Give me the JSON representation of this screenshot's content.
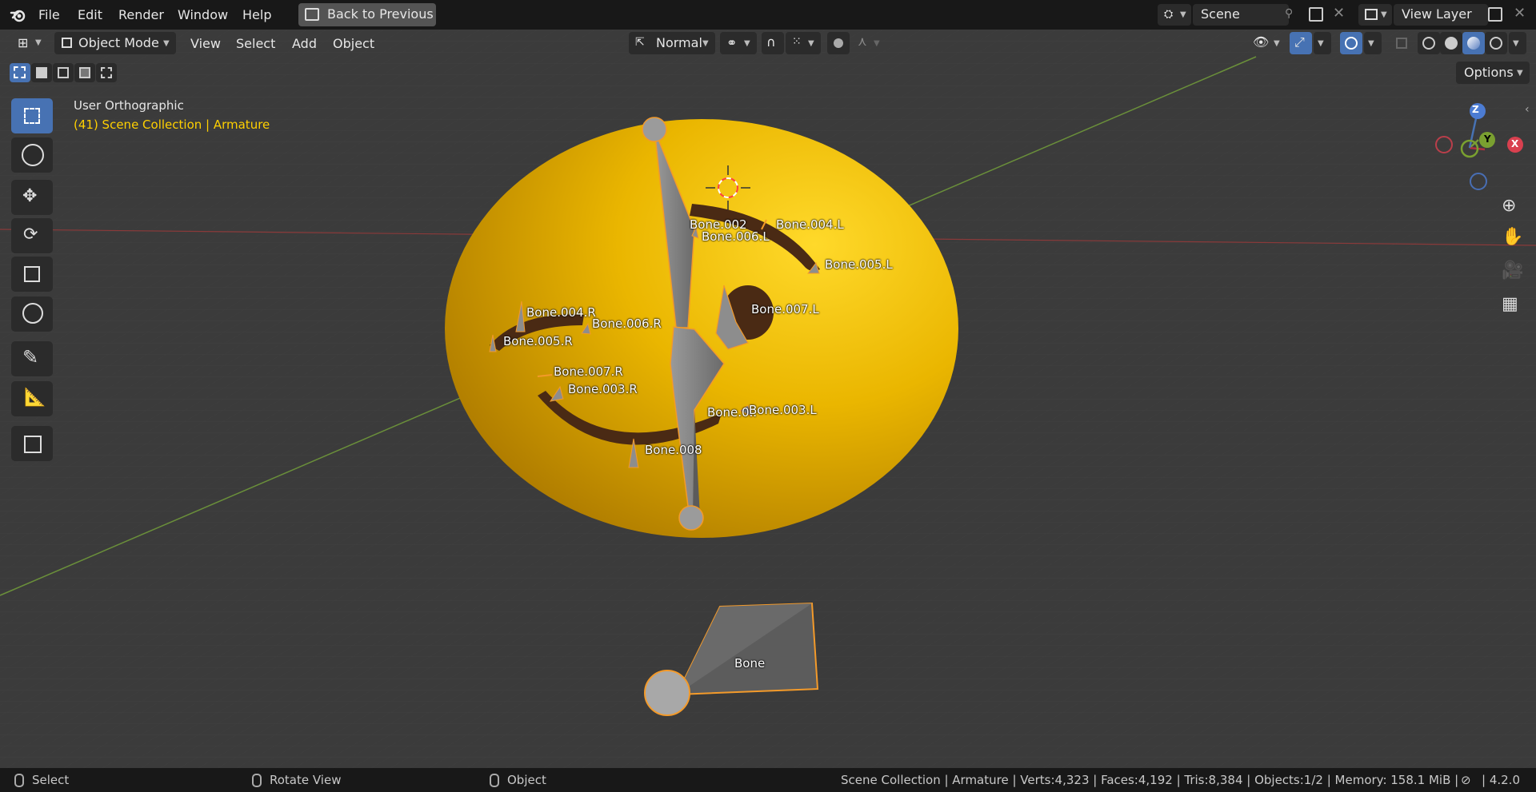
{
  "menubar": {
    "items": [
      "File",
      "Edit",
      "Render",
      "Window",
      "Help"
    ],
    "back_button": "Back to Previous",
    "scene": "Scene",
    "view_layer": "View Layer"
  },
  "header": {
    "mode": "Object Mode",
    "menus": [
      "View",
      "Select",
      "Add",
      "Object"
    ],
    "orientation": "Normal",
    "options": "Options"
  },
  "viewport": {
    "view_name": "User Orthographic",
    "collection_info": "(41) Scene Collection | Armature",
    "axes": {
      "x": "X",
      "y": "Y",
      "z": "Z"
    },
    "bone_labels": [
      "Bone.002",
      "Bone.004.L",
      "Bone.006.L",
      "Bone.005.L",
      "Bone.007.L",
      "Bone.004.R",
      "Bone.006.R",
      "Bone.005.R",
      "Bone.007.R",
      "Bone.003.R",
      "Bone.003.L",
      "Bone.0..",
      "Bone.008",
      "Bone"
    ]
  },
  "statusbar": {
    "select": "Select",
    "rotate": "Rotate View",
    "object": "Object",
    "stats": "Scene Collection | Armature | Verts:4,323 | Faces:4,192 | Tris:8,384 | Objects:1/2 | Memory: 158.1 MiB |",
    "version": "4.2.0"
  },
  "colors": {
    "accent": "#4772b3",
    "topbar": "#181818",
    "viewport": "#3a3a3a",
    "sphere": "#e8b800",
    "selection": "#f39a2a",
    "collection_text": "#ffd000"
  }
}
